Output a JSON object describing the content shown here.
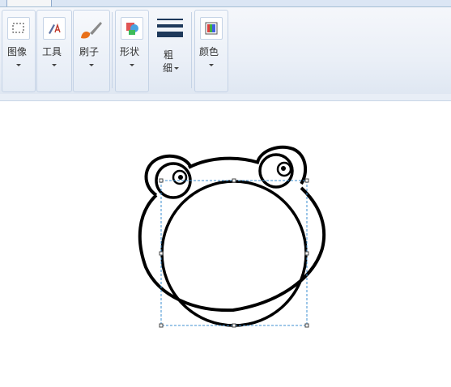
{
  "ribbon": {
    "image_label": "图像",
    "tools_label": "工具",
    "brushes_label": "刷子",
    "shapes_label": "形状",
    "size_label_1": "粗",
    "size_label_2": "细",
    "colors_label": "颜色"
  },
  "colors": {
    "ribbon_bg": "#eaeff7",
    "selection_border": "#3c8fd0"
  }
}
